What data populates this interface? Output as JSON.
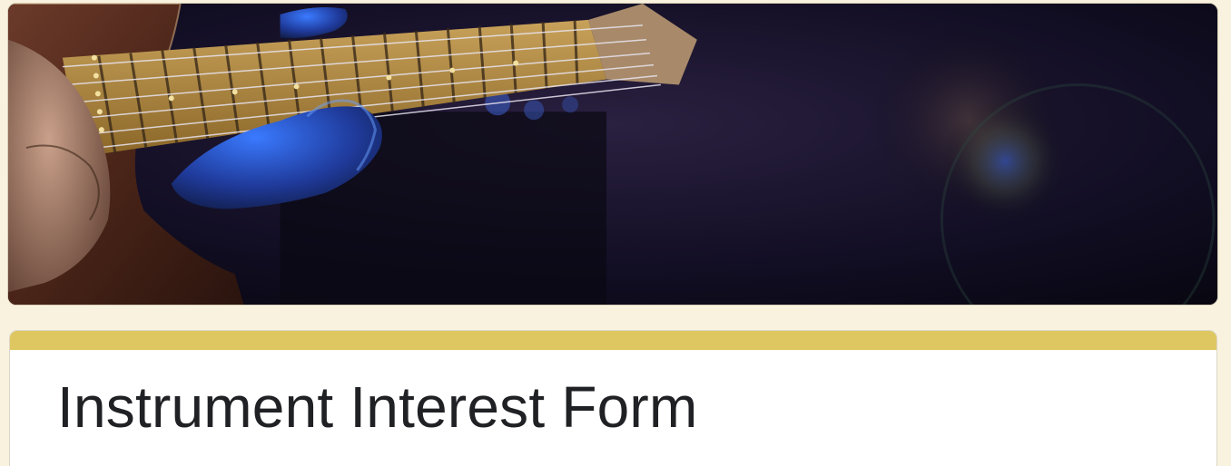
{
  "form": {
    "title": "Instrument Interest Form"
  },
  "header": {
    "image": "guitar-performance-banner"
  },
  "colors": {
    "page_background": "#f8f2df",
    "accent": "#dec761",
    "card_background": "#ffffff",
    "title_text": "#202124"
  }
}
